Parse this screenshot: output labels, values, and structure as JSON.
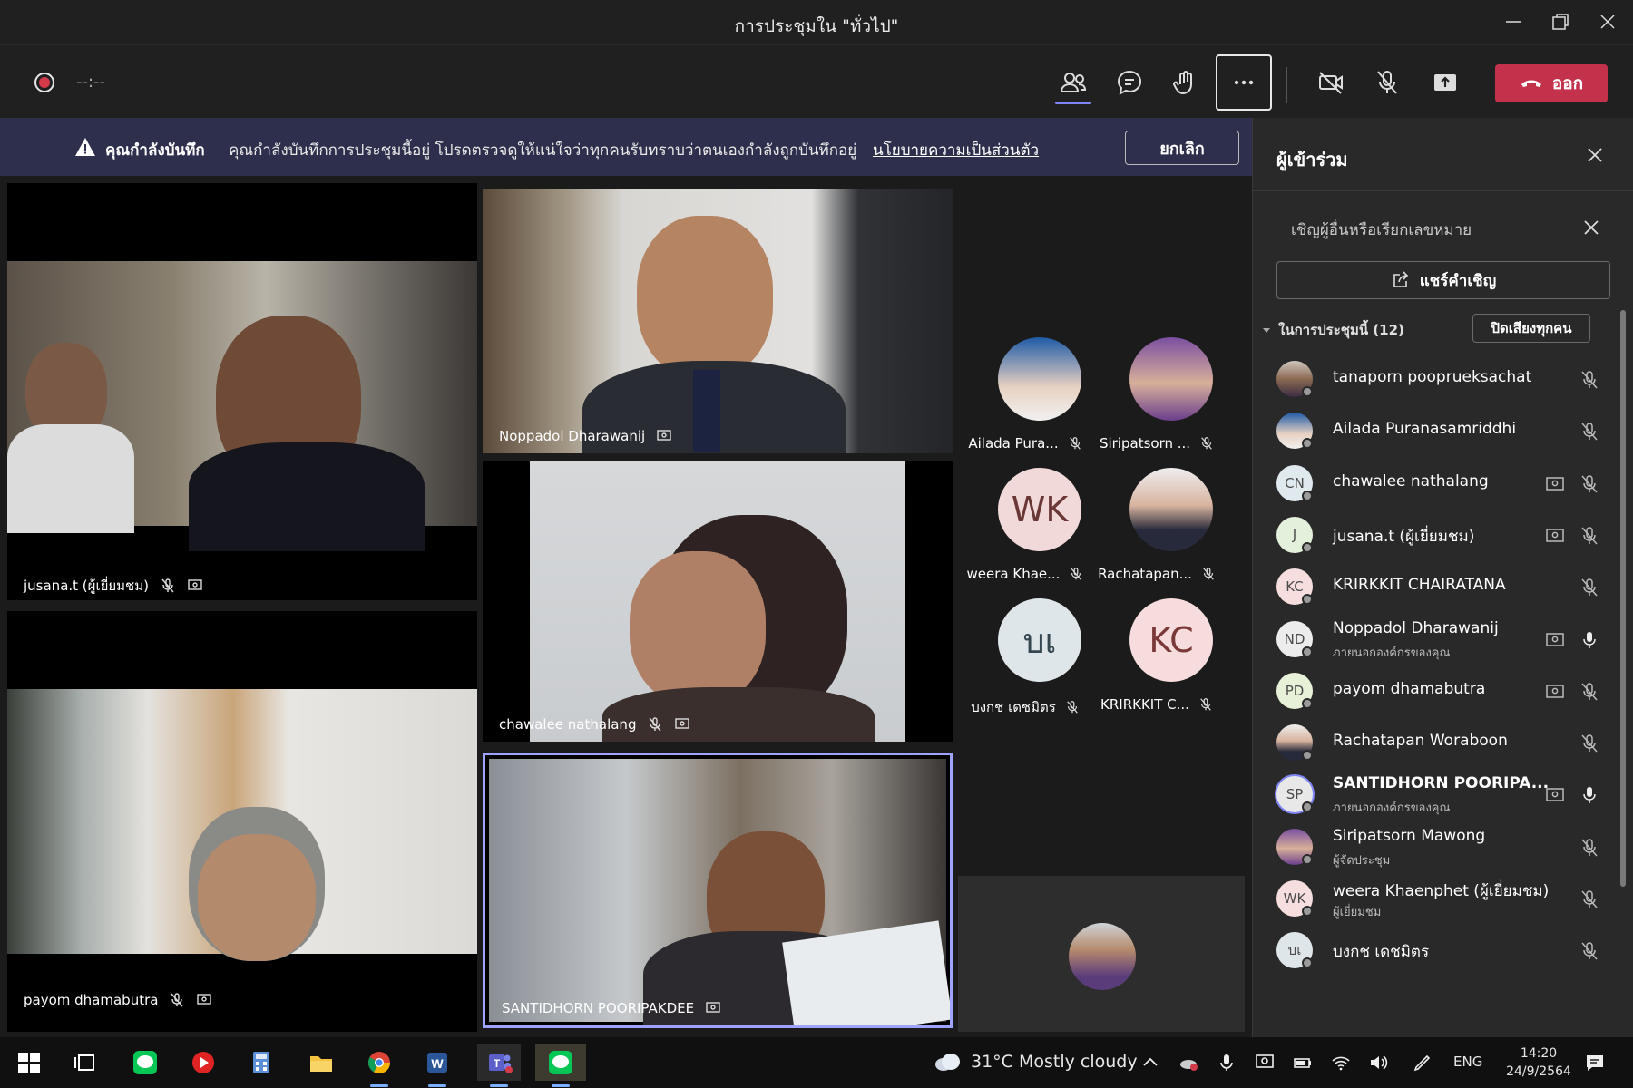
{
  "window": {
    "title": "การประชุมใน \"ทั่วไป\""
  },
  "toolbar": {
    "timer": "--:--",
    "leave_label": "ออก"
  },
  "banner": {
    "title": "คุณกำลังบันทึก",
    "message": "คุณกำลังบันทึกการประชุมนี้อยู่ โปรดตรวจดูให้แน่ใจว่าทุกคนรับทราบว่าตนเองกำลังถูกบันทึกอยู่",
    "link": "นโยบายความเป็นส่วนตัว",
    "cancel_label": "ยกเลิก"
  },
  "video_tiles": [
    {
      "name": "jusana.t (ผู้เยี่ยมชม)"
    },
    {
      "name": "Noppadol Dharawanij"
    },
    {
      "name": "chawalee nathalang"
    },
    {
      "name": "payom dhamabutra"
    },
    {
      "name": "SANTIDHORN POORIPAKDEE"
    }
  ],
  "avatar_grid": [
    {
      "label": "Ailada Pura...",
      "initials": ""
    },
    {
      "label": "Siripatsorn ...",
      "initials": ""
    },
    {
      "label": "weera Khae...",
      "initials": "WK"
    },
    {
      "label": "Rachatapan...",
      "initials": ""
    },
    {
      "label": "บงกช เดชมิตร",
      "initials": "บเ"
    },
    {
      "label": "KRIRKKIT C...",
      "initials": "KC"
    }
  ],
  "panel": {
    "title": "ผู้เข้าร่วม",
    "invite_placeholder": "เชิญผู้อื่นหรือเรียกเลขหมาย",
    "share_label": "แชร์คำเชิญ",
    "section_label": "ในการประชุมนี้ (12)",
    "mute_all_label": "ปิดเสียงทุกคน",
    "participants": [
      {
        "name": "tanaporn pooprueksachat",
        "initials": "",
        "sub": ""
      },
      {
        "name": "Ailada Puranasamriddhi",
        "initials": "",
        "sub": ""
      },
      {
        "name": "chawalee nathalang",
        "initials": "CN",
        "sub": ""
      },
      {
        "name": "jusana.t (ผู้เยี่ยมชม)",
        "initials": "J",
        "sub": ""
      },
      {
        "name": "KRIRKKIT CHAIRATANA",
        "initials": "KC",
        "sub": ""
      },
      {
        "name": "Noppadol Dharawanij",
        "initials": "ND",
        "sub": "ภายนอกองค์กรของคุณ"
      },
      {
        "name": "payom dhamabutra",
        "initials": "PD",
        "sub": ""
      },
      {
        "name": "Rachatapan Woraboon",
        "initials": "",
        "sub": ""
      },
      {
        "name": "SANTIDHORN POORIPA...",
        "initials": "SP",
        "sub": "ภายนอกองค์กรของคุณ"
      },
      {
        "name": "Siripatsorn Mawong",
        "initials": "",
        "sub": "ผู้จัดประชุม"
      },
      {
        "name": "weera Khaenphet (ผู้เยี่ยมชม)",
        "initials": "WK",
        "sub": "ผู้เยี่ยมชม"
      },
      {
        "name": "บงกช เดชมิตร",
        "initials": "บเ",
        "sub": ""
      }
    ]
  },
  "taskbar": {
    "weather": "31°C  Mostly cloudy",
    "lang": "ENG",
    "time": "14:20",
    "date": "24/9/2564"
  },
  "colors": {
    "accent": "#7f85f5",
    "leave": "#c4314b",
    "banner": "#2e2f4d"
  }
}
